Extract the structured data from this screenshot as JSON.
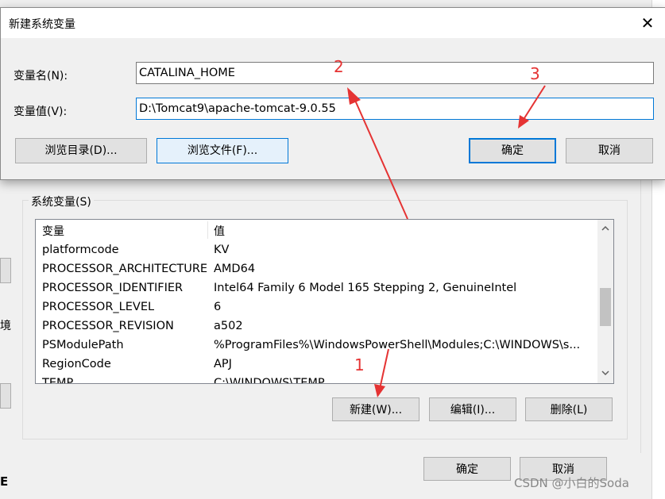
{
  "dialog": {
    "title": "新建系统变量",
    "close_glyph": "✕",
    "name_label": "变量名(N):",
    "name_value": "CATALINA_HOME",
    "value_label": "变量值(V):",
    "value_value": "D:\\Tomcat9\\apache-tomcat-9.0.55",
    "browse_dir_label": "浏览目录(D)...",
    "browse_file_label": "浏览文件(F)...",
    "ok_label": "确定",
    "cancel_label": "取消"
  },
  "system_vars": {
    "group_label": "系统变量(S)",
    "columns": [
      "变量",
      "值"
    ],
    "rows": [
      {
        "name": "platformcode",
        "value": "KV"
      },
      {
        "name": "PROCESSOR_ARCHITECTURE",
        "value": "AMD64"
      },
      {
        "name": "PROCESSOR_IDENTIFIER",
        "value": "Intel64 Family 6 Model 165 Stepping 2, GenuineIntel"
      },
      {
        "name": "PROCESSOR_LEVEL",
        "value": "6"
      },
      {
        "name": "PROCESSOR_REVISION",
        "value": "a502"
      },
      {
        "name": "PSModulePath",
        "value": "%ProgramFiles%\\WindowsPowerShell\\Modules;C:\\WINDOWS\\s..."
      },
      {
        "name": "RegionCode",
        "value": "APJ"
      },
      {
        "name": "TEMP",
        "value": "C:\\WINDOWS\\TEMP"
      }
    ],
    "new_label": "新建(W)...",
    "edit_label": "编辑(I)...",
    "delete_label": "删除(L)"
  },
  "env_window": {
    "ok_label": "确定",
    "cancel_label": "取消"
  },
  "annotations": {
    "one": "1",
    "two": "2",
    "three": "3",
    "color": "#e53333"
  },
  "watermark": "CSDN @小白的Soda",
  "bg_fragments": {
    "jing": "境",
    "e": "E"
  },
  "colors": {
    "accent": "#0078d7",
    "dialog_bg": "#f0f0f0",
    "button_bg": "#e1e1e1"
  }
}
